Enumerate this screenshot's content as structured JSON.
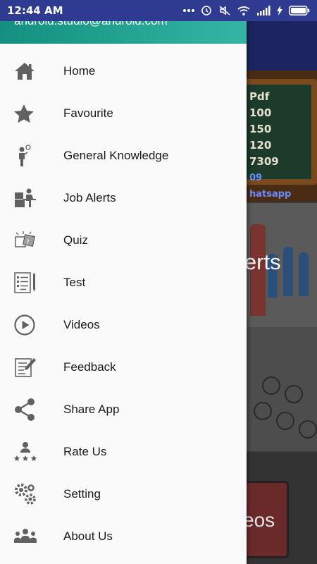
{
  "status_bar": {
    "time": "12:44 AM"
  },
  "drawer": {
    "email": "android.studio@android.com",
    "items": [
      {
        "label": "Home",
        "icon": "home-icon"
      },
      {
        "label": "Favourite",
        "icon": "star-icon"
      },
      {
        "label": "General Knowledge",
        "icon": "person-idea-icon"
      },
      {
        "label": "Job Alerts",
        "icon": "person-desk-icon"
      },
      {
        "label": "Quiz",
        "icon": "quiz-icon"
      },
      {
        "label": "Test",
        "icon": "checklist-icon"
      },
      {
        "label": "Videos",
        "icon": "play-circle-icon"
      },
      {
        "label": "Feedback",
        "icon": "feedback-edit-icon"
      },
      {
        "label": "Share App",
        "icon": "share-icon"
      },
      {
        "label": "Rate Us",
        "icon": "rating-person-icon"
      },
      {
        "label": "Setting",
        "icon": "gears-icon"
      },
      {
        "label": "About Us",
        "icon": "group-icon"
      }
    ]
  },
  "background": {
    "card1_lines": [
      "Pdf",
      "100",
      "150",
      "120",
      "7309",
      "09",
      "hatsapp"
    ],
    "card2_text": "lerts",
    "card4_text": "eos"
  },
  "colors": {
    "status_bar": "#2f3a91",
    "drawer_header": "#13907f",
    "icon_gray": "#616161"
  }
}
